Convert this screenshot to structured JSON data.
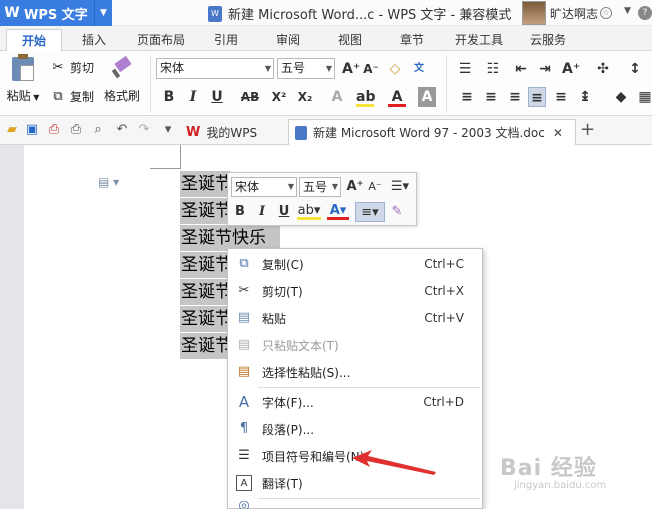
{
  "title_bar": {
    "app_name": "WPS 文字",
    "window_title": "新建 Microsoft Word...c - WPS 文字 - 兼容模式",
    "user_name": "旷达啊志"
  },
  "ribbon_tabs": [
    "开始",
    "插入",
    "页面布局",
    "引用",
    "审阅",
    "视图",
    "章节",
    "开发工具",
    "云服务"
  ],
  "ribbon": {
    "paste": "粘贴",
    "cut": "剪切",
    "copy": "复制",
    "format_painter": "格式刷",
    "font_name": "宋体",
    "font_size": "五号"
  },
  "quick_bar": {
    "tab_wps": "我的WPS",
    "tab_doc": "新建 Microsoft Word 97 - 2003 文档.doc"
  },
  "document": {
    "lines": [
      "圣诞节",
      "圣诞节",
      "圣诞节快乐",
      "圣诞节",
      "圣诞节",
      "圣诞节",
      "圣诞节"
    ]
  },
  "mini_toolbar": {
    "font_name": "宋体",
    "font_size": "五号"
  },
  "context_menu": [
    {
      "label": "复制(C)",
      "shortcut": "Ctrl+C",
      "icon": "copy-icon",
      "enabled": true
    },
    {
      "label": "剪切(T)",
      "shortcut": "Ctrl+X",
      "icon": "scissors-icon",
      "enabled": true
    },
    {
      "label": "粘贴",
      "shortcut": "Ctrl+V",
      "icon": "paste-icon",
      "enabled": true
    },
    {
      "label": "只粘贴文本(T)",
      "shortcut": "",
      "icon": "paste-text-icon",
      "enabled": false
    },
    {
      "label": "选择性粘贴(S)...",
      "shortcut": "",
      "icon": "paste-special-icon",
      "enabled": true
    },
    {
      "label": "字体(F)...",
      "shortcut": "Ctrl+D",
      "icon": "font-icon",
      "enabled": true
    },
    {
      "label": "段落(P)...",
      "shortcut": "",
      "icon": "paragraph-icon",
      "enabled": true
    },
    {
      "label": "项目符号和编号(N)...",
      "shortcut": "",
      "icon": "bullets-icon",
      "enabled": true
    },
    {
      "label": "翻译(T)",
      "shortcut": "",
      "icon": "translate-icon",
      "enabled": true
    }
  ],
  "watermark": {
    "brand": "Bai 经验",
    "url": "jingyan.baidu.com"
  },
  "colors": {
    "accent": "#3a7de0",
    "selection": "#c5c5c5",
    "arrow": "#e03030"
  }
}
